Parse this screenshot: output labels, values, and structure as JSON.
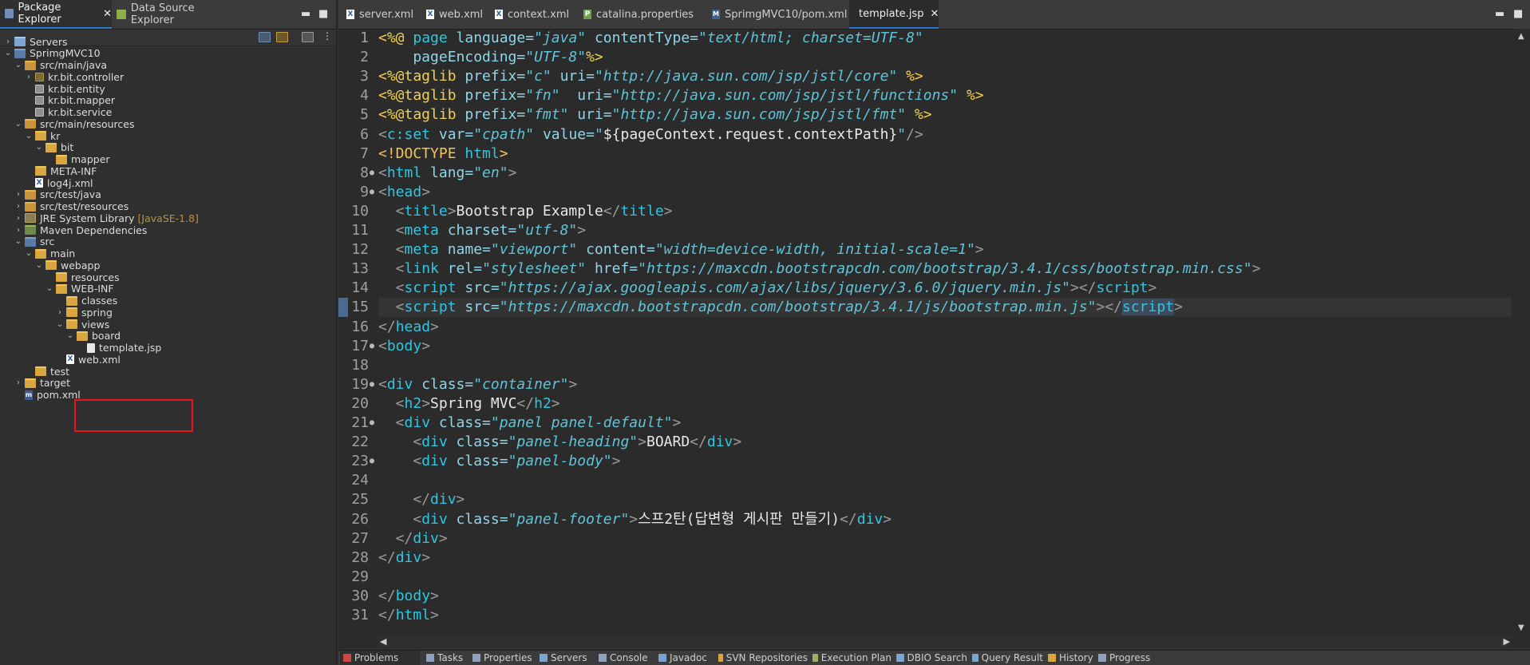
{
  "left_panel": {
    "tabs": [
      {
        "label": "Package Explorer",
        "icon": "package-explorer-icon",
        "active": true
      },
      {
        "label": "Data Source Explorer",
        "icon": "data-source-icon",
        "active": false
      }
    ],
    "tree": [
      {
        "label": "Servers",
        "depth": 0,
        "arrow": "right",
        "icon": "server"
      },
      {
        "label": "SprimgMVC10",
        "depth": 0,
        "arrow": "down",
        "icon": "proj"
      },
      {
        "label": "src/main/java",
        "depth": 1,
        "arrow": "down",
        "icon": "pkgfolder"
      },
      {
        "label": "kr.bit.controller",
        "depth": 2,
        "arrow": "right",
        "icon": "pkg"
      },
      {
        "label": "kr.bit.entity",
        "depth": 2,
        "arrow": "",
        "icon": "pkg-empty"
      },
      {
        "label": "kr.bit.mapper",
        "depth": 2,
        "arrow": "",
        "icon": "pkg-empty"
      },
      {
        "label": "kr.bit.service",
        "depth": 2,
        "arrow": "",
        "icon": "pkg-empty"
      },
      {
        "label": "src/main/resources",
        "depth": 1,
        "arrow": "down",
        "icon": "pkgfolder"
      },
      {
        "label": "kr",
        "depth": 2,
        "arrow": "down",
        "icon": "folder"
      },
      {
        "label": "bit",
        "depth": 3,
        "arrow": "down",
        "icon": "folder"
      },
      {
        "label": "mapper",
        "depth": 4,
        "arrow": "",
        "icon": "folder"
      },
      {
        "label": "META-INF",
        "depth": 2,
        "arrow": "",
        "icon": "folder"
      },
      {
        "label": "log4j.xml",
        "depth": 2,
        "arrow": "",
        "icon": "xml"
      },
      {
        "label": "src/test/java",
        "depth": 1,
        "arrow": "right",
        "icon": "pkgfolder"
      },
      {
        "label": "src/test/resources",
        "depth": 1,
        "arrow": "right",
        "icon": "pkgfolder"
      },
      {
        "label": "JRE System Library",
        "depth": 1,
        "arrow": "right",
        "icon": "lib",
        "decoration": "[JavaSE-1.8]"
      },
      {
        "label": "Maven Dependencies",
        "depth": 1,
        "arrow": "right",
        "icon": "maven"
      },
      {
        "label": "src",
        "depth": 1,
        "arrow": "down",
        "icon": "proj"
      },
      {
        "label": "main",
        "depth": 2,
        "arrow": "down",
        "icon": "folder"
      },
      {
        "label": "webapp",
        "depth": 3,
        "arrow": "down",
        "icon": "folder"
      },
      {
        "label": "resources",
        "depth": 4,
        "arrow": "",
        "icon": "folder"
      },
      {
        "label": "WEB-INF",
        "depth": 4,
        "arrow": "down",
        "icon": "folder"
      },
      {
        "label": "classes",
        "depth": 5,
        "arrow": "",
        "icon": "folder"
      },
      {
        "label": "spring",
        "depth": 5,
        "arrow": "right",
        "icon": "folder"
      },
      {
        "label": "views",
        "depth": 5,
        "arrow": "down",
        "icon": "folder"
      },
      {
        "label": "board",
        "depth": 6,
        "arrow": "down",
        "icon": "folder"
      },
      {
        "label": "template.jsp",
        "depth": 7,
        "arrow": "",
        "icon": "jsp"
      },
      {
        "label": "web.xml",
        "depth": 5,
        "arrow": "",
        "icon": "xml"
      },
      {
        "label": "test",
        "depth": 2,
        "arrow": "",
        "icon": "folder"
      },
      {
        "label": "target",
        "depth": 1,
        "arrow": "right",
        "icon": "folder"
      },
      {
        "label": "pom.xml",
        "depth": 1,
        "arrow": "",
        "icon": "pom"
      }
    ]
  },
  "editor": {
    "tabs": [
      {
        "label": "server.xml",
        "icon": "xml",
        "active": false
      },
      {
        "label": "web.xml",
        "icon": "xml",
        "active": false
      },
      {
        "label": "context.xml",
        "icon": "xml",
        "active": false
      },
      {
        "label": "catalina.properties",
        "icon": "props",
        "active": false
      },
      {
        "label": "SprimgMVC10/pom.xml",
        "icon": "pom",
        "active": false
      },
      {
        "label": "template.jsp",
        "icon": "jsp",
        "active": true
      }
    ],
    "current_line": 15,
    "lines": [
      {
        "n": "1",
        "fold": "",
        "t": [
          [
            "dir",
            "<%@ "
          ],
          [
            "kw",
            "page "
          ],
          [
            "attr",
            "language="
          ],
          [
            "val",
            "\"java\" "
          ],
          [
            "attr",
            "contentType="
          ],
          [
            "val",
            "\"text/html; charset=UTF-8\""
          ]
        ]
      },
      {
        "n": "2",
        "fold": "",
        "t": [
          [
            "attr",
            "    pageEncoding="
          ],
          [
            "val",
            "\"UTF-8\""
          ],
          [
            "dir",
            "%>"
          ]
        ]
      },
      {
        "n": "3",
        "fold": "",
        "t": [
          [
            "dir",
            "<%@taglib "
          ],
          [
            "attr",
            "prefix="
          ],
          [
            "val",
            "\"c\" "
          ],
          [
            "attr",
            "uri="
          ],
          [
            "val",
            "\"http://java.sun.com/jsp/jstl/core\" "
          ],
          [
            "dir",
            "%>"
          ]
        ]
      },
      {
        "n": "4",
        "fold": "",
        "t": [
          [
            "dir",
            "<%@taglib "
          ],
          [
            "attr",
            "prefix="
          ],
          [
            "val",
            "\"fn\"  "
          ],
          [
            "attr",
            "uri="
          ],
          [
            "val",
            "\"http://java.sun.com/jsp/jstl/functions\" "
          ],
          [
            "dir",
            "%>"
          ]
        ]
      },
      {
        "n": "5",
        "fold": "",
        "t": [
          [
            "dir",
            "<%@taglib "
          ],
          [
            "attr",
            "prefix="
          ],
          [
            "val",
            "\"fmt\" "
          ],
          [
            "attr",
            "uri="
          ],
          [
            "val",
            "\"http://java.sun.com/jsp/jstl/fmt\" "
          ],
          [
            "dir",
            "%>"
          ]
        ]
      },
      {
        "n": "6",
        "fold": "",
        "t": [
          [
            "punc",
            "<"
          ],
          [
            "kw",
            "c:set "
          ],
          [
            "attr",
            "var="
          ],
          [
            "val",
            "\"cpath\" "
          ],
          [
            "attr",
            "value="
          ],
          [
            "val",
            "\""
          ],
          [
            "txt",
            "${pageContext.request.contextPath}"
          ],
          [
            "val",
            "\""
          ],
          [
            "punc",
            "/>"
          ]
        ]
      },
      {
        "n": "7",
        "fold": "",
        "t": [
          [
            "doc",
            "<!DOCTYPE "
          ],
          [
            "kw",
            "html"
          ],
          [
            "doc",
            ">"
          ]
        ]
      },
      {
        "n": "8",
        "fold": "●",
        "t": [
          [
            "punc",
            "<"
          ],
          [
            "kw",
            "html "
          ],
          [
            "attr",
            "lang="
          ],
          [
            "val",
            "\"en\""
          ],
          [
            "punc",
            ">"
          ]
        ]
      },
      {
        "n": "9",
        "fold": "●",
        "t": [
          [
            "punc",
            "<"
          ],
          [
            "kw",
            "head"
          ],
          [
            "punc",
            ">"
          ]
        ]
      },
      {
        "n": "10",
        "fold": "",
        "t": [
          [
            "punc",
            "  <"
          ],
          [
            "kw",
            "title"
          ],
          [
            "punc",
            ">"
          ],
          [
            "txt",
            "Bootstrap Example"
          ],
          [
            "punc",
            "</"
          ],
          [
            "kw",
            "title"
          ],
          [
            "punc",
            ">"
          ]
        ]
      },
      {
        "n": "11",
        "fold": "",
        "t": [
          [
            "punc",
            "  <"
          ],
          [
            "kw",
            "meta "
          ],
          [
            "attr",
            "charset="
          ],
          [
            "val",
            "\"utf-8\""
          ],
          [
            "punc",
            ">"
          ]
        ]
      },
      {
        "n": "12",
        "fold": "",
        "t": [
          [
            "punc",
            "  <"
          ],
          [
            "kw",
            "meta "
          ],
          [
            "attr",
            "name="
          ],
          [
            "val",
            "\"viewport\" "
          ],
          [
            "attr",
            "content="
          ],
          [
            "val",
            "\"width=device-width, initial-scale=1\""
          ],
          [
            "punc",
            ">"
          ]
        ]
      },
      {
        "n": "13",
        "fold": "",
        "t": [
          [
            "punc",
            "  <"
          ],
          [
            "kw",
            "link "
          ],
          [
            "attr",
            "rel="
          ],
          [
            "val",
            "\"stylesheet\" "
          ],
          [
            "attr",
            "href="
          ],
          [
            "val",
            "\"https://maxcdn.bootstrapcdn.com/bootstrap/3.4.1/css/bootstrap.min.css\""
          ],
          [
            "punc",
            ">"
          ]
        ]
      },
      {
        "n": "14",
        "fold": "",
        "t": [
          [
            "punc",
            "  <"
          ],
          [
            "kw",
            "script "
          ],
          [
            "attr",
            "src="
          ],
          [
            "val",
            "\"https://ajax.googleapis.com/ajax/libs/jquery/3.6.0/jquery.min.js\""
          ],
          [
            "punc",
            "></"
          ],
          [
            "kw",
            "script"
          ],
          [
            "punc",
            ">"
          ]
        ]
      },
      {
        "n": "15",
        "fold": "",
        "t": [
          [
            "punc",
            "  <"
          ],
          [
            "kw",
            "script "
          ],
          [
            "attr",
            "src="
          ],
          [
            "val",
            "\"https://maxcdn.bootstrapcdn.com/bootstrap/3.4.1/js/bootstrap.min.js\""
          ],
          [
            "punc",
            "></"
          ],
          [
            "kwhl",
            "script"
          ],
          [
            "punc",
            ">"
          ]
        ]
      },
      {
        "n": "16",
        "fold": "",
        "t": [
          [
            "punc",
            "</"
          ],
          [
            "kw",
            "head"
          ],
          [
            "punc",
            ">"
          ]
        ]
      },
      {
        "n": "17",
        "fold": "●",
        "t": [
          [
            "punc",
            "<"
          ],
          [
            "kw",
            "body"
          ],
          [
            "punc",
            ">"
          ]
        ]
      },
      {
        "n": "18",
        "fold": "",
        "t": []
      },
      {
        "n": "19",
        "fold": "●",
        "t": [
          [
            "punc",
            "<"
          ],
          [
            "kw",
            "div "
          ],
          [
            "attr",
            "class="
          ],
          [
            "val",
            "\"container\""
          ],
          [
            "punc",
            ">"
          ]
        ]
      },
      {
        "n": "20",
        "fold": "",
        "t": [
          [
            "punc",
            "  <"
          ],
          [
            "kw",
            "h2"
          ],
          [
            "punc",
            ">"
          ],
          [
            "txt",
            "Spring MVC"
          ],
          [
            "punc",
            "</"
          ],
          [
            "kw",
            "h2"
          ],
          [
            "punc",
            ">"
          ]
        ]
      },
      {
        "n": "21",
        "fold": "●",
        "t": [
          [
            "punc",
            "  <"
          ],
          [
            "kw",
            "div "
          ],
          [
            "attr",
            "class="
          ],
          [
            "val",
            "\"panel panel-default\""
          ],
          [
            "punc",
            ">"
          ]
        ]
      },
      {
        "n": "22",
        "fold": "",
        "t": [
          [
            "punc",
            "    <"
          ],
          [
            "kw",
            "div "
          ],
          [
            "attr",
            "class="
          ],
          [
            "val",
            "\"panel-heading\""
          ],
          [
            "punc",
            ">"
          ],
          [
            "txt",
            "BOARD"
          ],
          [
            "punc",
            "</"
          ],
          [
            "kw",
            "div"
          ],
          [
            "punc",
            ">"
          ]
        ]
      },
      {
        "n": "23",
        "fold": "●",
        "t": [
          [
            "punc",
            "    <"
          ],
          [
            "kw",
            "div "
          ],
          [
            "attr",
            "class="
          ],
          [
            "val",
            "\"panel-body\""
          ],
          [
            "punc",
            ">"
          ]
        ]
      },
      {
        "n": "24",
        "fold": "",
        "t": []
      },
      {
        "n": "25",
        "fold": "",
        "t": [
          [
            "punc",
            "    </"
          ],
          [
            "kw",
            "div"
          ],
          [
            "punc",
            ">"
          ]
        ]
      },
      {
        "n": "26",
        "fold": "",
        "t": [
          [
            "punc",
            "    <"
          ],
          [
            "kw",
            "div "
          ],
          [
            "attr",
            "class="
          ],
          [
            "val",
            "\"panel-footer\""
          ],
          [
            "punc",
            ">"
          ],
          [
            "txt",
            "스프2탄(답변형 게시판 만들기)"
          ],
          [
            "punc",
            "</"
          ],
          [
            "kw",
            "div"
          ],
          [
            "punc",
            ">"
          ]
        ]
      },
      {
        "n": "27",
        "fold": "",
        "t": [
          [
            "punc",
            "  </"
          ],
          [
            "kw",
            "div"
          ],
          [
            "punc",
            ">"
          ]
        ]
      },
      {
        "n": "28",
        "fold": "",
        "t": [
          [
            "punc",
            "</"
          ],
          [
            "kw",
            "div"
          ],
          [
            "punc",
            ">"
          ]
        ]
      },
      {
        "n": "29",
        "fold": "",
        "t": []
      },
      {
        "n": "30",
        "fold": "",
        "t": [
          [
            "punc",
            "</"
          ],
          [
            "kw",
            "body"
          ],
          [
            "punc",
            ">"
          ]
        ]
      },
      {
        "n": "31",
        "fold": "",
        "t": [
          [
            "punc",
            "</"
          ],
          [
            "kw",
            "html"
          ],
          [
            "punc",
            ">"
          ]
        ]
      }
    ]
  },
  "bottom_tabs": [
    {
      "label": "Problems",
      "active": true
    },
    {
      "label": "Tasks"
    },
    {
      "label": "Properties"
    },
    {
      "label": "Servers"
    },
    {
      "label": "Console"
    },
    {
      "label": "Javadoc"
    },
    {
      "label": "SVN Repositories"
    },
    {
      "label": "Execution Plan"
    },
    {
      "label": "DBIO Search"
    },
    {
      "label": "Query Result"
    },
    {
      "label": "History"
    },
    {
      "label": "Progress"
    }
  ]
}
